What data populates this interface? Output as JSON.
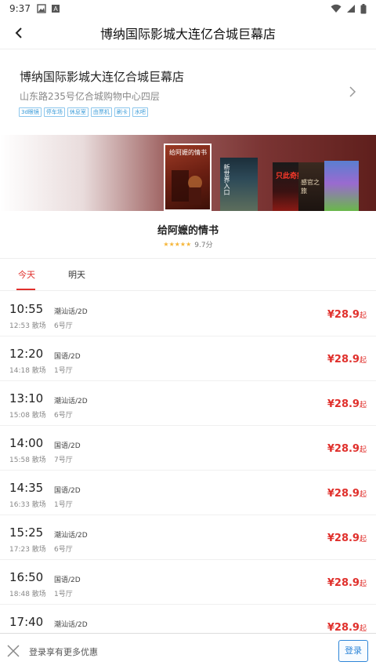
{
  "status_bar": {
    "time": "9:37"
  },
  "header": {
    "title": "博纳国际影城大连亿合城巨幕店"
  },
  "cinema": {
    "name": "博纳国际影城大连亿合城巨幕店",
    "address": "山东路235号亿合城购物中心四层",
    "tags": [
      "3d眼镜",
      "停车场",
      "休息室",
      "由票机",
      "刷卡",
      "水吧"
    ]
  },
  "posters": [
    {
      "name": "poster-1",
      "text": "给阿嬷的情书"
    },
    {
      "name": "poster-2",
      "text": "新世界入口"
    },
    {
      "name": "poster-3",
      "text": "只此奇舞"
    },
    {
      "name": "poster-4",
      "text": "感官之旅"
    },
    {
      "name": "poster-5",
      "text": ""
    }
  ],
  "movie": {
    "title": "给阿嬷的情书",
    "stars": "★★★★★",
    "score": "9.7分"
  },
  "tabs": [
    {
      "label": "今天",
      "active": true
    },
    {
      "label": "明天",
      "active": false
    }
  ],
  "sessions": [
    {
      "start": "10:55",
      "end": "12:53 散场",
      "lang": "潮汕话/2D",
      "hall": "6号厅",
      "price": "¥28.9",
      "suffix": "起"
    },
    {
      "start": "12:20",
      "end": "14:18 散场",
      "lang": "国语/2D",
      "hall": "1号厅",
      "price": "¥28.9",
      "suffix": "起"
    },
    {
      "start": "13:10",
      "end": "15:08 散场",
      "lang": "潮汕话/2D",
      "hall": "6号厅",
      "price": "¥28.9",
      "suffix": "起"
    },
    {
      "start": "14:00",
      "end": "15:58 散场",
      "lang": "国语/2D",
      "hall": "7号厅",
      "price": "¥28.9",
      "suffix": "起"
    },
    {
      "start": "14:35",
      "end": "16:33 散场",
      "lang": "国语/2D",
      "hall": "1号厅",
      "price": "¥28.9",
      "suffix": "起"
    },
    {
      "start": "15:25",
      "end": "17:23 散场",
      "lang": "潮汕话/2D",
      "hall": "6号厅",
      "price": "¥28.9",
      "suffix": "起"
    },
    {
      "start": "16:50",
      "end": "18:48 散场",
      "lang": "国语/2D",
      "hall": "1号厅",
      "price": "¥28.9",
      "suffix": "起"
    },
    {
      "start": "17:40",
      "end": "",
      "lang": "潮汕话/2D",
      "hall": "",
      "price": "¥28.9",
      "suffix": "起"
    }
  ],
  "login_bar": {
    "text": "登录享有更多优惠",
    "button": "登录"
  },
  "colors": {
    "accent_red": "#e0302c",
    "link_blue": "#2f86d8",
    "tag_blue": "#3a9bd8"
  }
}
